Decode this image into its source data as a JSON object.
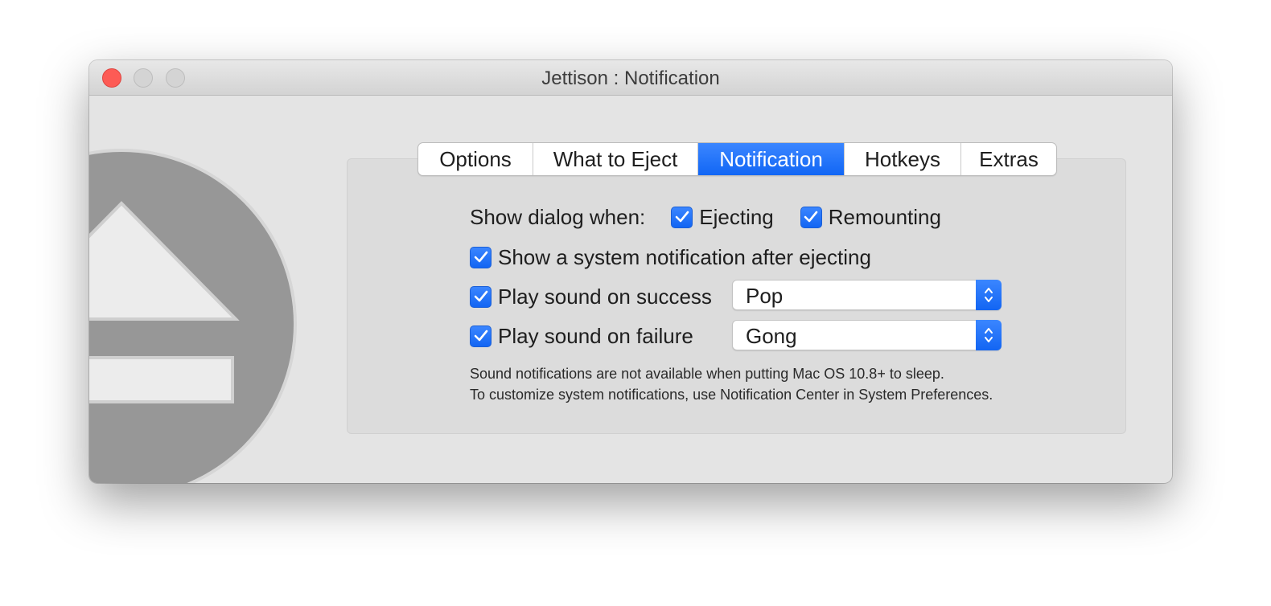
{
  "window": {
    "title": "Jettison : Notification"
  },
  "tabs": [
    {
      "label": "Options"
    },
    {
      "label": "What to Eject"
    },
    {
      "label": "Notification"
    },
    {
      "label": "Hotkeys"
    },
    {
      "label": "Extras"
    }
  ],
  "active_tab": "Notification",
  "dialog": {
    "label": "Show dialog when:",
    "ejecting": {
      "label": "Ejecting",
      "checked": true
    },
    "remounting": {
      "label": "Remounting",
      "checked": true
    }
  },
  "system_notification": {
    "label": "Show a system notification after ejecting",
    "checked": true
  },
  "sound_success": {
    "label": "Play sound on success",
    "checked": true,
    "selected": "Pop"
  },
  "sound_failure": {
    "label": "Play sound on failure",
    "checked": true,
    "selected": "Gong"
  },
  "notes": {
    "line1": "Sound notifications are not available when putting Mac OS 10.8+ to sleep.",
    "line2": "To customize system notifications, use Notification Center in System Preferences."
  },
  "colors": {
    "accent": "#1a6dff",
    "close_button": "#fd5b55"
  },
  "icons": {
    "app_logo": "eject-icon",
    "checkbox": "checkmark-icon",
    "popup": "up-down-chevron-icon"
  }
}
